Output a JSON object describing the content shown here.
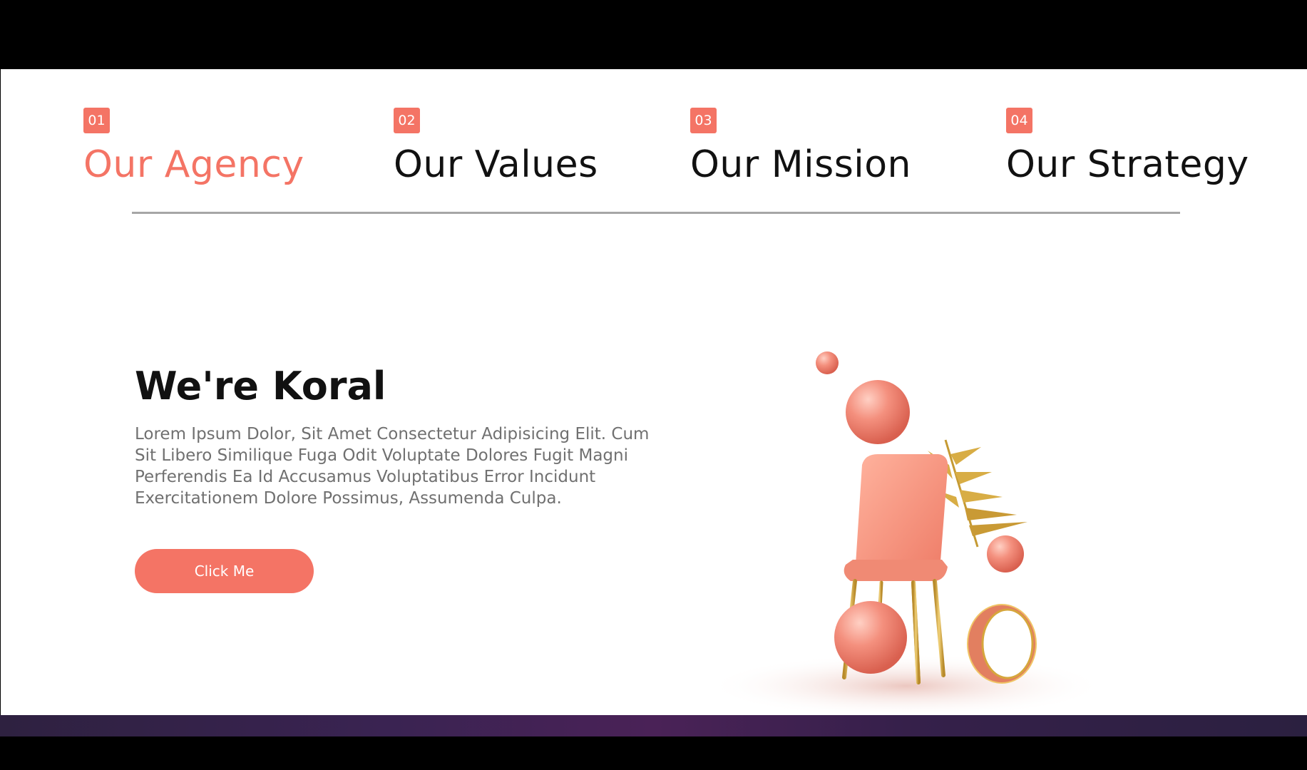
{
  "tabs": [
    {
      "number": "01",
      "label": "Our Agency",
      "active": true
    },
    {
      "number": "02",
      "label": "Our Values",
      "active": false
    },
    {
      "number": "03",
      "label": "Our Mission",
      "active": false
    },
    {
      "number": "04",
      "label": "Our Strategy",
      "active": false
    }
  ],
  "content": {
    "headline": "We're Koral",
    "body": "Lorem Ipsum Dolor, Sit Amet Consectetur Adipisicing Elit. Cum Sit Libero Similique Fuga Odit Voluptate Dolores Fugit Magni Perferendis Ea Id Accusamus Voluptatibus Error Incidunt Exercitationem Dolore Possimus, Assumenda Culpa.",
    "button_label": "Click Me"
  },
  "colors": {
    "accent": "#f47465",
    "heading": "#111111",
    "body_text": "#707070",
    "divider": "#a6a6a6"
  },
  "illustration": {
    "subject": "coral chair with spheres, gold palm leaf and ring"
  }
}
